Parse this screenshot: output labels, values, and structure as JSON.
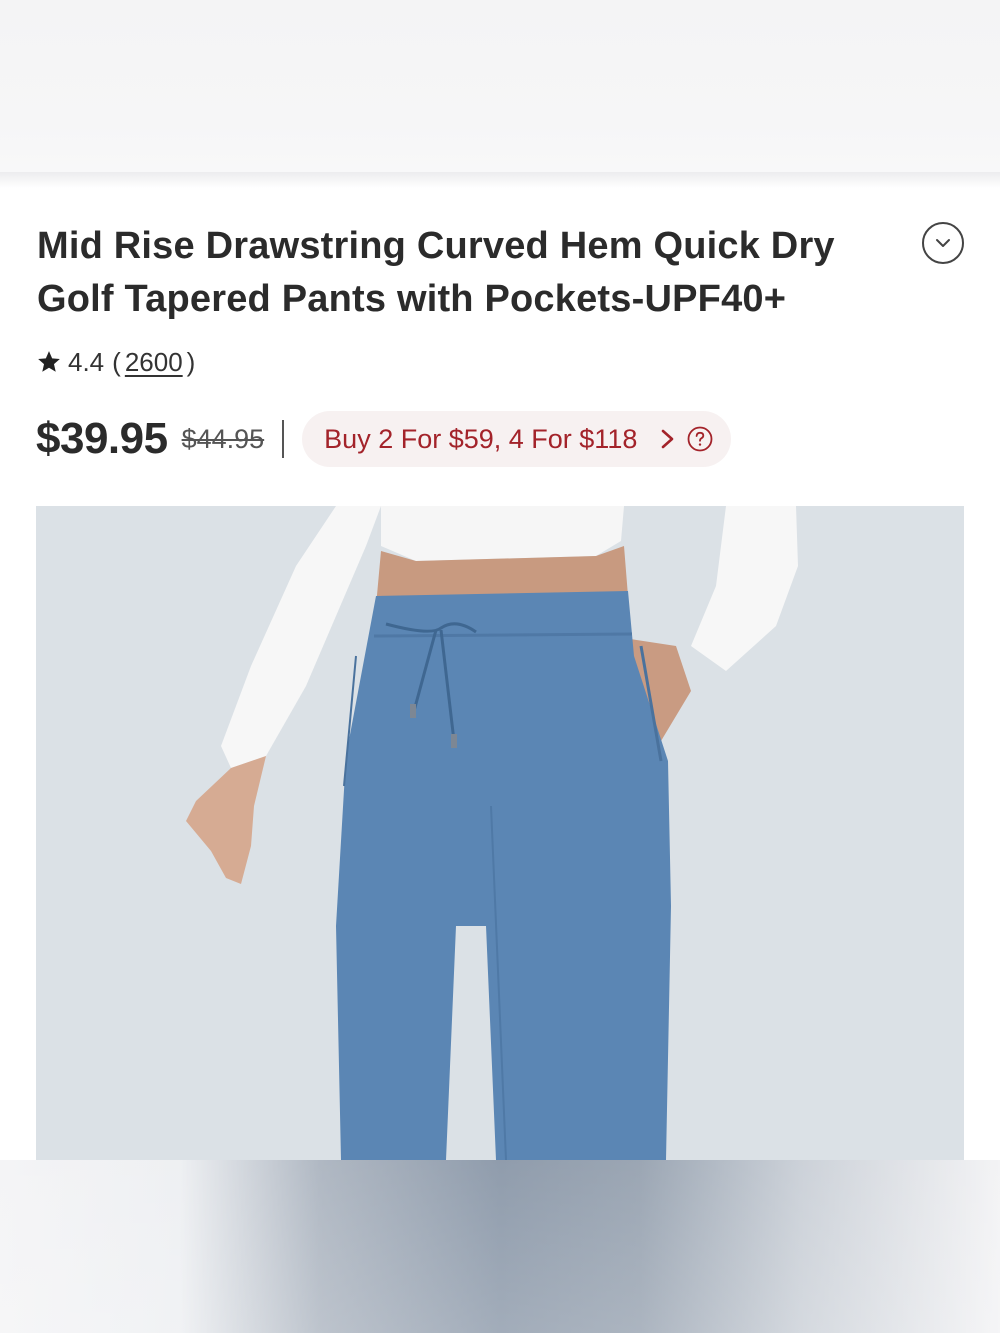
{
  "product": {
    "title": "Mid Rise Drawstring Curved Hem Quick Dry Golf Tapered Pants with Pockets-UPF40+",
    "rating": "4.4",
    "review_open": "(",
    "review_count": "2600",
    "review_close": ")",
    "price_current": "$39.95",
    "price_original": "$44.95",
    "promo_text": "Buy 2 For $59, 4 For $118"
  },
  "icons": {
    "collapse": "chevron-down-icon",
    "star": "star-icon",
    "promo_arrow": "chevron-right-icon",
    "help": "question-circle-icon"
  },
  "colors": {
    "promo_text": "#a3232a",
    "promo_bg": "#f7f1f1",
    "pants": "#5b86b4",
    "image_bg": "#dbe1e6"
  }
}
